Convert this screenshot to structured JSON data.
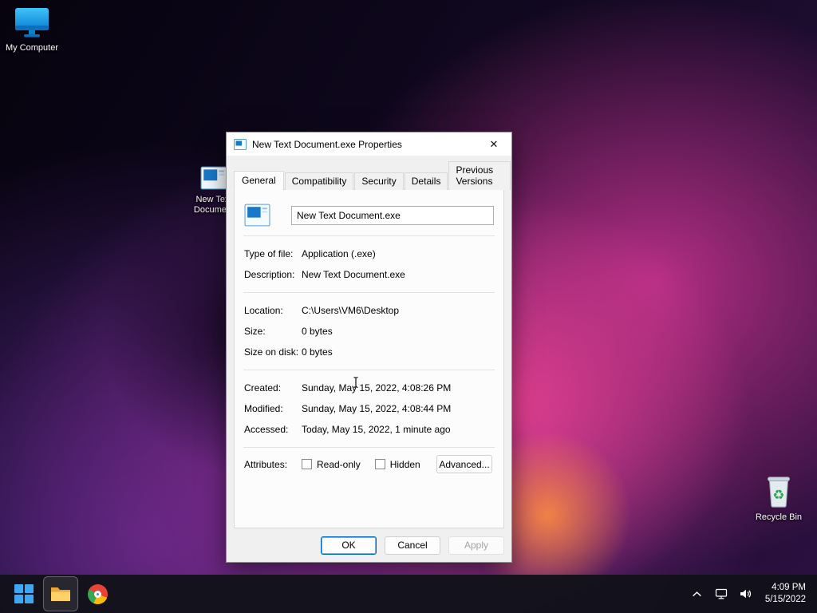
{
  "desktop": {
    "icons": {
      "my_computer": "My Computer",
      "new_text_document": "New Text Document",
      "recycle_bin": "Recycle Bin"
    }
  },
  "dialog": {
    "title": "New Text Document.exe Properties",
    "close_glyph": "✕",
    "tabs": [
      {
        "label": "General"
      },
      {
        "label": "Compatibility"
      },
      {
        "label": "Security"
      },
      {
        "label": "Details"
      },
      {
        "label": "Previous Versions"
      }
    ],
    "filename": "New Text Document.exe",
    "fields": {
      "type_label": "Type of file:",
      "type_value": "Application (.exe)",
      "description_label": "Description:",
      "description_value": "New Text Document.exe",
      "location_label": "Location:",
      "location_value": "C:\\Users\\VM6\\Desktop",
      "size_label": "Size:",
      "size_value": "0 bytes",
      "size_on_disk_label": "Size on disk:",
      "size_on_disk_value": "0 bytes",
      "created_label": "Created:",
      "created_value": "Sunday, May 15, 2022, 4:08:26 PM",
      "modified_label": "Modified:",
      "modified_value": "Sunday, May 15, 2022, 4:08:44 PM",
      "accessed_label": "Accessed:",
      "accessed_value": "Today, May 15, 2022, 1 minute ago",
      "attributes_label": "Attributes:",
      "readonly_label": "Read-only",
      "hidden_label": "Hidden",
      "advanced_button": "Advanced..."
    },
    "buttons": {
      "ok": "OK",
      "cancel": "Cancel",
      "apply": "Apply"
    }
  },
  "taskbar": {
    "time": "4:09 PM",
    "date": "5/15/2022"
  }
}
